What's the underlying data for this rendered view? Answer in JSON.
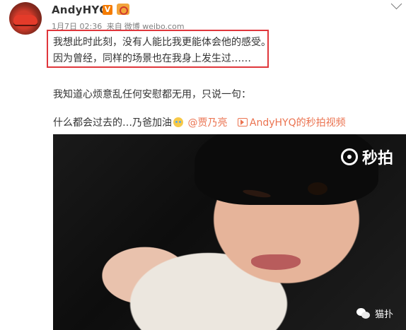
{
  "post": {
    "username": "AndyHYQ",
    "verified_badge": "V",
    "date": "1月7日 02:36",
    "source_prefix": "来自",
    "source": "微博 weibo.com",
    "lines": [
      "我想此时此刻，没有人能比我更能体会他的感受。",
      "因为曾经，同样的场景也在我身上发生过……",
      "我知道心烦意乱任何安慰都无用，只说一句："
    ],
    "last_line_text": "什么都会过去的…乃爸加油",
    "mention": "@贾乃亮",
    "video_link": "AndyHYQ的秒拍视频",
    "icons": {
      "avatar": "avatar-ferrari",
      "badge": "verified-v-icon",
      "vip": "vip-icon",
      "menu": "chevron-down-icon",
      "emoji": "crying-emoji-icon",
      "video": "video-icon"
    }
  },
  "video": {
    "watermark_logo": "秒拍",
    "source_watermark": "猫扑"
  },
  "colors": {
    "link": "#eb7350",
    "highlight_border": "#e0363b",
    "text": "#333333",
    "meta": "#808080"
  }
}
